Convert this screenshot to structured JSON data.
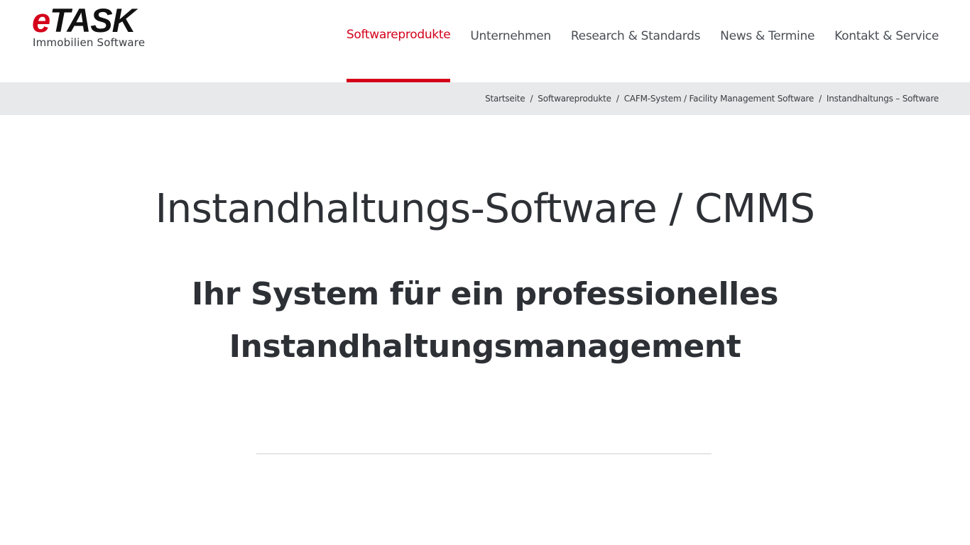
{
  "logo": {
    "e": "e",
    "task": "TASK",
    "subtitle": "Immobilien  Software"
  },
  "nav": {
    "items": [
      {
        "label": "Softwareprodukte",
        "active": true
      },
      {
        "label": "Unternehmen",
        "active": false
      },
      {
        "label": "Research & Standards",
        "active": false
      },
      {
        "label": "News & Termine",
        "active": false
      },
      {
        "label": "Kontakt & Service",
        "active": false
      }
    ]
  },
  "breadcrumb": {
    "items": [
      "Startseite",
      "Softwareprodukte",
      "CAFM-System / Facility Management Software",
      "Instandhaltungs – Software"
    ],
    "separator": "/"
  },
  "main": {
    "title": "Instandhaltungs-Software / CMMS",
    "subtitle_line1": "Ihr System für ein professionelles",
    "subtitle_line2": "Instandhaltungsmanagement"
  },
  "colors": {
    "accent": "#d4001a",
    "text": "#2d3035",
    "breadcrumb_bg": "#e8e9eb"
  }
}
